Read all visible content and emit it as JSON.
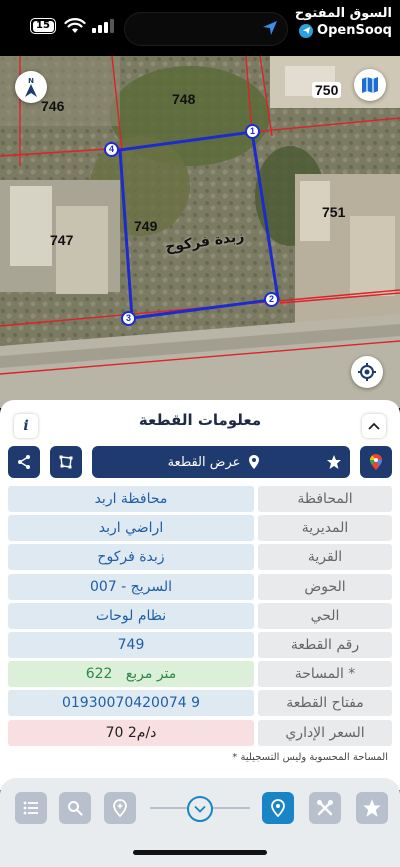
{
  "status": {
    "battery": "15",
    "brand_ar": "السوق المفتوح",
    "brand_en": "OpenSooq"
  },
  "map": {
    "plots": {
      "p746": "746",
      "p748": "748",
      "p750": "750",
      "p751": "751",
      "p747": "747",
      "p749": "749"
    },
    "vertices": [
      "1",
      "2",
      "3",
      "4"
    ],
    "village_label": "زبدة فركوح",
    "boundary_color": "#1c2bd0",
    "parcel_line_color": "#e0202a"
  },
  "panel": {
    "title": "معلومات القطعة",
    "info_button": "i",
    "show_plot_button": "عرض القطعة",
    "rows": [
      {
        "label": "المحافظة",
        "value": "محافظة اربد"
      },
      {
        "label": "المديرية",
        "value": "اراضي اربد"
      },
      {
        "label": "القرية",
        "value": "زبدة فركوح"
      },
      {
        "label": "الحوض",
        "value": "السريج - 007"
      },
      {
        "label": "الحي",
        "value": "نظام لوحات"
      },
      {
        "label": "رقم القطعة",
        "value": "749"
      },
      {
        "label": "المساحة *",
        "value": "622   متر مربع"
      },
      {
        "label": "مفتاح القطعة",
        "value": "01930070420074 9"
      },
      {
        "label": "السعر الإداري",
        "value": "70 د/م2"
      }
    ],
    "footnote": "* المساحة المحسوبة وليس التسجيلية"
  },
  "colors": {
    "primary": "#1e3a6e",
    "accent": "#1985c7",
    "value_bg": "#dfe9f2",
    "area_bg": "#dcefd9",
    "price_bg": "#f7dfe2"
  }
}
